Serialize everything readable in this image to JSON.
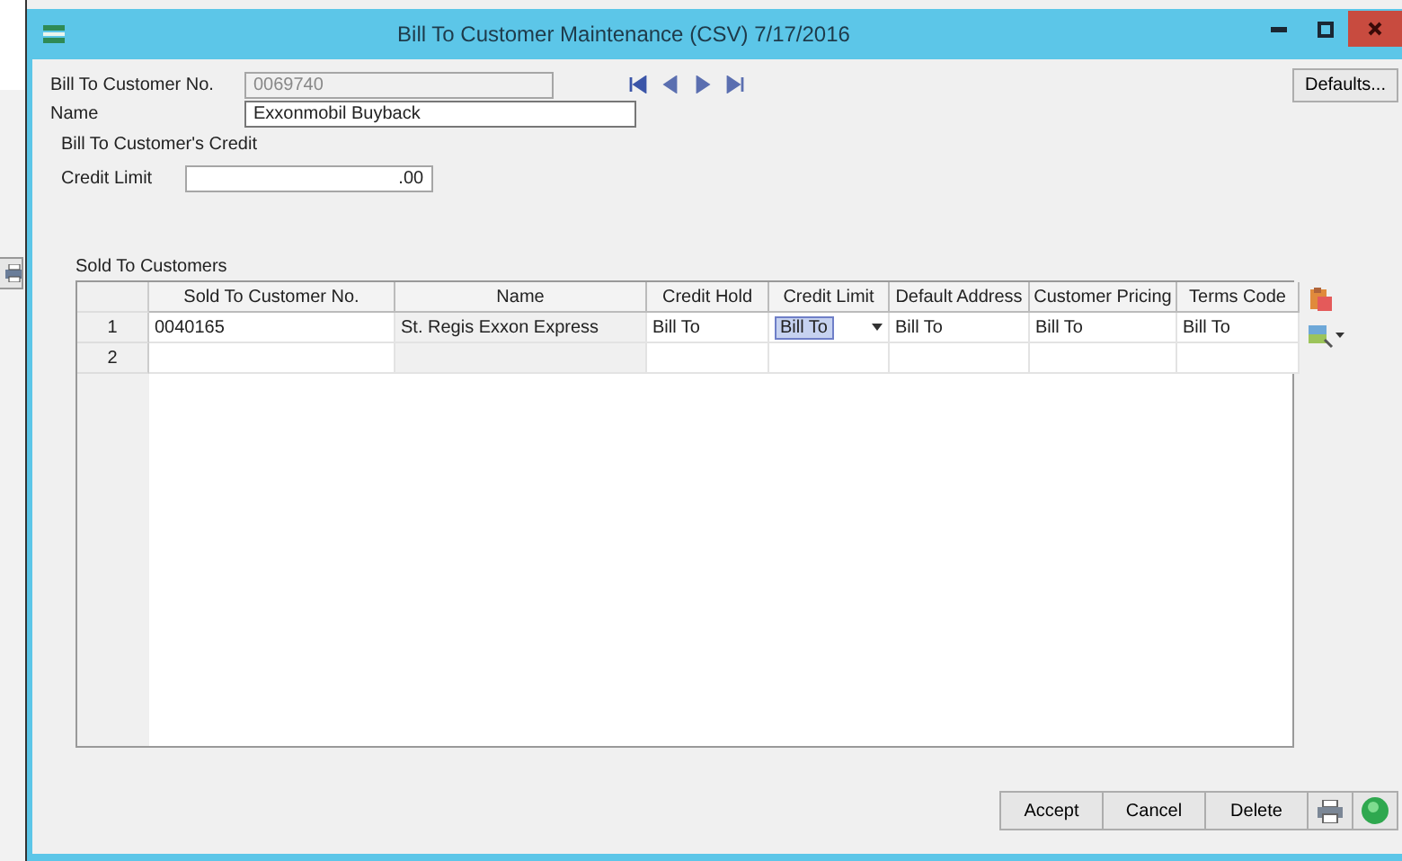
{
  "window": {
    "title": "Bill To Customer Maintenance (CSV) 7/17/2016"
  },
  "header": {
    "customer_no_label": "Bill To Customer No.",
    "customer_no": "0069740",
    "customer_no_disabled": true,
    "name_label": "Name",
    "name": "Exxonmobil Buyback",
    "defaults_button": "Defaults..."
  },
  "credit": {
    "group_label": "Bill To Customer's Credit",
    "credit_limit_label": "Credit Limit",
    "credit_limit": ".00"
  },
  "grid": {
    "title": "Sold To Customers",
    "columns": [
      "Sold To Customer No.",
      "Name",
      "Credit Hold",
      "Credit Limit",
      "Default Address",
      "Customer Pricing",
      "Terms Code"
    ],
    "rows": [
      {
        "number": "1",
        "cells": [
          {
            "text": "0040165",
            "selected": false
          },
          {
            "text": "St. Regis Exxon Express",
            "selected": false
          },
          {
            "text": "Bill To",
            "selected": false
          },
          {
            "text": "Bill To",
            "selected": true
          },
          {
            "text": "Bill To",
            "selected": false
          },
          {
            "text": "Bill To",
            "selected": false
          },
          {
            "text": "Bill To",
            "selected": false
          }
        ]
      },
      {
        "number": "2",
        "cells": []
      }
    ]
  },
  "buttons": [
    {
      "label": "Accept"
    },
    {
      "label": "Cancel"
    },
    {
      "label": "Delete"
    }
  ]
}
